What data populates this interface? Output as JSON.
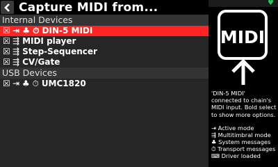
{
  "header": {
    "back_icon": "chevron-left-icon",
    "title": "Capture MIDI from..."
  },
  "sections": [
    {
      "label": "Internal Devices",
      "rows": [
        {
          "check": "☒",
          "icons": "⇥ ♣ ⏱",
          "label": "DIN-5 MIDI",
          "selected": true
        },
        {
          "check": "☒",
          "icons": "⇶",
          "label": "MIDI player",
          "selected": false
        },
        {
          "check": "☒",
          "icons": "⇶",
          "label": "Step-Sequencer",
          "selected": false
        },
        {
          "check": "☒",
          "icons": "⇶",
          "label": "CV/Gate",
          "selected": false
        }
      ]
    },
    {
      "label": "USB Devices",
      "rows": [
        {
          "check": "☒",
          "icons": "⇥ ♣ ⏱",
          "label": "UMC1820",
          "selected": false
        }
      ]
    }
  ],
  "side": {
    "status_icon": "heart-icon",
    "logo_text": "MIDI",
    "help_text": "'DIN-5 MIDI' connected to chain's MIDI input. Bold select to show more options.",
    "legend": [
      "⇥ Active mode",
      "⇶ Multitimbral mode",
      "♣ System messages",
      "⏱ Transport messages",
      "⌨ Driver loaded"
    ]
  },
  "colors": {
    "selected_row": "#ff2424",
    "status_ok": "#22cc55"
  }
}
